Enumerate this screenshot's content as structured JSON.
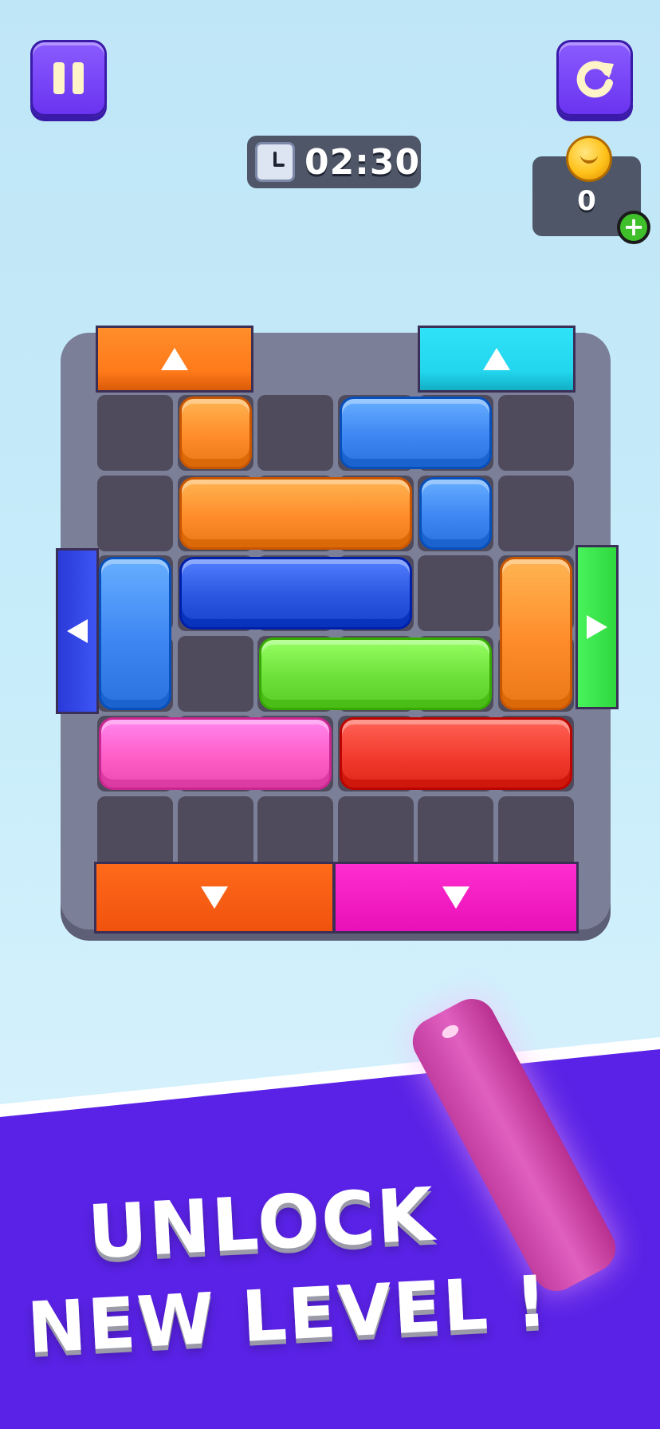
{
  "hud": {
    "timer": "02:30",
    "coins": "0",
    "plus_label": "+"
  },
  "board": {
    "rows": 6,
    "cols": 6,
    "gates": [
      {
        "name": "gate-top-orange",
        "color": "#ff7a1a",
        "direction": "up"
      },
      {
        "name": "gate-top-cyan",
        "color": "#22d6ee",
        "direction": "up"
      },
      {
        "name": "gate-left-blue",
        "color": "#2d43e6",
        "direction": "left"
      },
      {
        "name": "gate-right-green",
        "color": "#3df04f",
        "direction": "right"
      },
      {
        "name": "gate-bottom-orange",
        "color": "#ff5a14",
        "direction": "down"
      },
      {
        "name": "gate-bottom-magenta",
        "color": "#ff1fc8",
        "direction": "down"
      }
    ],
    "blocks": [
      {
        "name": "block-orange-l",
        "color": "#ff8c2a",
        "shape": "L",
        "cells": [
          [
            1,
            0
          ],
          [
            1,
            1
          ],
          [
            2,
            1
          ],
          [
            3,
            1
          ]
        ]
      },
      {
        "name": "block-blue-corner",
        "color": "#3e86f2",
        "shape": "corner",
        "cells": [
          [
            3,
            0
          ],
          [
            4,
            0
          ],
          [
            4,
            1
          ]
        ]
      },
      {
        "name": "block-blue-vertical",
        "color": "#3e86f2",
        "shape": "vertical",
        "cells": [
          [
            0,
            2
          ],
          [
            0,
            3
          ]
        ]
      },
      {
        "name": "block-darkblue-horizontal",
        "color": "#2a56e0",
        "shape": "horizontal",
        "cells": [
          [
            1,
            2
          ],
          [
            2,
            2
          ],
          [
            3,
            2
          ]
        ]
      },
      {
        "name": "block-orange-vertical",
        "color": "#ff8c2a",
        "shape": "vertical",
        "cells": [
          [
            5,
            2
          ],
          [
            5,
            3
          ]
        ]
      },
      {
        "name": "block-green-horizontal",
        "color": "#6de03a",
        "shape": "horizontal",
        "cells": [
          [
            2,
            3
          ],
          [
            3,
            3
          ],
          [
            4,
            3
          ]
        ]
      },
      {
        "name": "block-pink-horizontal",
        "color": "#ff5ec7",
        "shape": "horizontal",
        "cells": [
          [
            0,
            4
          ],
          [
            1,
            4
          ],
          [
            2,
            4
          ]
        ]
      },
      {
        "name": "block-red-horizontal",
        "color": "#f23b2e",
        "shape": "horizontal",
        "cells": [
          [
            3,
            4
          ],
          [
            4,
            4
          ],
          [
            5,
            4
          ]
        ]
      }
    ]
  },
  "promo": {
    "line1": "UNLOCK",
    "line2": "NEW LEVEL !",
    "banner_color": "#5a22e6"
  }
}
